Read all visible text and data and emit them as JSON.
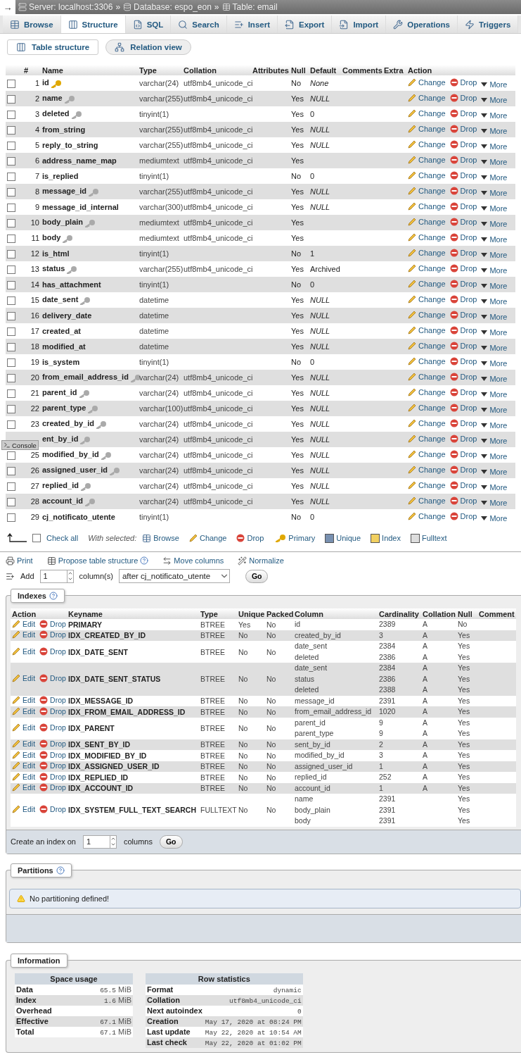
{
  "breadcrumb": {
    "arrow": "→",
    "separator": "»",
    "items": [
      {
        "label": "Server: localhost:3306"
      },
      {
        "label": "Database: espo_eon"
      },
      {
        "label": "Table: email"
      }
    ]
  },
  "tabs": [
    {
      "label": "Browse",
      "selected": false
    },
    {
      "label": "Structure",
      "selected": true
    },
    {
      "label": "SQL",
      "selected": false
    },
    {
      "label": "Search",
      "selected": false
    },
    {
      "label": "Insert",
      "selected": false
    },
    {
      "label": "Export",
      "selected": false
    },
    {
      "label": "Import",
      "selected": false
    },
    {
      "label": "Operations",
      "selected": false
    },
    {
      "label": "Triggers",
      "selected": false
    }
  ],
  "subtabs": [
    {
      "label": "Table structure",
      "selected": true
    },
    {
      "label": "Relation view",
      "selected": false
    }
  ],
  "structure": {
    "columns": [
      "#",
      "Name",
      "Type",
      "Collation",
      "Attributes",
      "Null",
      "Default",
      "Comments",
      "Extra",
      "Action"
    ],
    "rows": [
      {
        "checked": false,
        "num": "1",
        "name": "id",
        "kind": "primary",
        "type": "varchar(24)",
        "collation": "utf8mb4_unicode_ci",
        "null": "No",
        "default": "None",
        "default_keyword": true,
        "actions": [
          "Change",
          "Drop",
          "More"
        ]
      },
      {
        "checked": false,
        "num": "2",
        "name": "name",
        "kind": "indexed",
        "type": "varchar(255)",
        "collation": "utf8mb4_unicode_ci",
        "null": "Yes",
        "default": "NULL",
        "default_keyword": true,
        "actions": [
          "Change",
          "Drop",
          "More"
        ]
      },
      {
        "checked": false,
        "num": "3",
        "name": "deleted",
        "kind": "indexed",
        "type": "tinyint(1)",
        "null": "Yes",
        "default": "0",
        "actions": [
          "Change",
          "Drop",
          "More"
        ]
      },
      {
        "checked": false,
        "num": "4",
        "name": "from_string",
        "type": "varchar(255)",
        "collation": "utf8mb4_unicode_ci",
        "null": "Yes",
        "default": "NULL",
        "default_keyword": true,
        "actions": [
          "Change",
          "Drop",
          "More"
        ]
      },
      {
        "checked": false,
        "num": "5",
        "name": "reply_to_string",
        "type": "varchar(255)",
        "collation": "utf8mb4_unicode_ci",
        "null": "Yes",
        "default": "NULL",
        "default_keyword": true,
        "actions": [
          "Change",
          "Drop",
          "More"
        ]
      },
      {
        "checked": false,
        "num": "6",
        "name": "address_name_map",
        "type": "mediumtext",
        "collation": "utf8mb4_unicode_ci",
        "null": "Yes",
        "actions": [
          "Change",
          "Drop",
          "More"
        ]
      },
      {
        "checked": false,
        "num": "7",
        "name": "is_replied",
        "type": "tinyint(1)",
        "null": "No",
        "default": "0",
        "actions": [
          "Change",
          "Drop",
          "More"
        ]
      },
      {
        "checked": false,
        "num": "8",
        "name": "message_id",
        "kind": "indexed",
        "type": "varchar(255)",
        "collation": "utf8mb4_unicode_ci",
        "null": "Yes",
        "default": "NULL",
        "default_keyword": true,
        "actions": [
          "Change",
          "Drop",
          "More"
        ]
      },
      {
        "checked": false,
        "num": "9",
        "name": "message_id_internal",
        "type": "varchar(300)",
        "collation": "utf8mb4_unicode_ci",
        "null": "Yes",
        "default": "NULL",
        "default_keyword": true,
        "actions": [
          "Change",
          "Drop",
          "More"
        ]
      },
      {
        "checked": false,
        "num": "10",
        "name": "body_plain",
        "kind": "indexed",
        "type": "mediumtext",
        "collation": "utf8mb4_unicode_ci",
        "null": "Yes",
        "actions": [
          "Change",
          "Drop",
          "More"
        ]
      },
      {
        "checked": false,
        "num": "11",
        "name": "body",
        "kind": "indexed",
        "type": "mediumtext",
        "collation": "utf8mb4_unicode_ci",
        "null": "Yes",
        "actions": [
          "Change",
          "Drop",
          "More"
        ]
      },
      {
        "checked": false,
        "num": "12",
        "name": "is_html",
        "type": "tinyint(1)",
        "null": "No",
        "default": "1",
        "actions": [
          "Change",
          "Drop",
          "More"
        ]
      },
      {
        "checked": false,
        "num": "13",
        "name": "status",
        "kind": "indexed",
        "type": "varchar(255)",
        "collation": "utf8mb4_unicode_ci",
        "null": "Yes",
        "default": "Archived",
        "actions": [
          "Change",
          "Drop",
          "More"
        ]
      },
      {
        "checked": false,
        "num": "14",
        "name": "has_attachment",
        "type": "tinyint(1)",
        "null": "No",
        "default": "0",
        "actions": [
          "Change",
          "Drop",
          "More"
        ]
      },
      {
        "checked": false,
        "num": "15",
        "name": "date_sent",
        "kind": "indexed",
        "type": "datetime",
        "null": "Yes",
        "default": "NULL",
        "default_keyword": true,
        "actions": [
          "Change",
          "Drop",
          "More"
        ]
      },
      {
        "checked": false,
        "num": "16",
        "name": "delivery_date",
        "type": "datetime",
        "null": "Yes",
        "default": "NULL",
        "default_keyword": true,
        "actions": [
          "Change",
          "Drop",
          "More"
        ]
      },
      {
        "checked": false,
        "num": "17",
        "name": "created_at",
        "type": "datetime",
        "null": "Yes",
        "default": "NULL",
        "default_keyword": true,
        "actions": [
          "Change",
          "Drop",
          "More"
        ]
      },
      {
        "checked": false,
        "num": "18",
        "name": "modified_at",
        "type": "datetime",
        "null": "Yes",
        "default": "NULL",
        "default_keyword": true,
        "actions": [
          "Change",
          "Drop",
          "More"
        ]
      },
      {
        "checked": false,
        "num": "19",
        "name": "is_system",
        "type": "tinyint(1)",
        "null": "No",
        "default": "0",
        "actions": [
          "Change",
          "Drop",
          "More"
        ]
      },
      {
        "checked": false,
        "num": "20",
        "name": "from_email_address_id",
        "kind": "indexed",
        "type": "varchar(24)",
        "collation": "utf8mb4_unicode_ci",
        "null": "Yes",
        "default": "NULL",
        "default_keyword": true,
        "actions": [
          "Change",
          "Drop",
          "More"
        ]
      },
      {
        "checked": false,
        "num": "21",
        "name": "parent_id",
        "kind": "indexed",
        "type": "varchar(24)",
        "collation": "utf8mb4_unicode_ci",
        "null": "Yes",
        "default": "NULL",
        "default_keyword": true,
        "actions": [
          "Change",
          "Drop",
          "More"
        ]
      },
      {
        "checked": false,
        "num": "22",
        "name": "parent_type",
        "kind": "indexed",
        "type": "varchar(100)",
        "collation": "utf8mb4_unicode_ci",
        "null": "Yes",
        "default": "NULL",
        "default_keyword": true,
        "actions": [
          "Change",
          "Drop",
          "More"
        ]
      },
      {
        "checked": false,
        "num": "23",
        "name": "created_by_id",
        "kind": "indexed",
        "type": "varchar(24)",
        "collation": "utf8mb4_unicode_ci",
        "null": "Yes",
        "default": "NULL",
        "default_keyword": true,
        "actions": [
          "Change",
          "Drop",
          "More"
        ]
      },
      {
        "name": "ent_by_id",
        "kind": "indexed",
        "type": "varchar(24)",
        "collation": "utf8mb4_unicode_ci",
        "null": "Yes",
        "default": "NULL",
        "default_keyword": true,
        "actions": [
          "Change",
          "Drop",
          "More"
        ]
      },
      {
        "checked": false,
        "num": "25",
        "name": "modified_by_id",
        "kind": "indexed",
        "type": "varchar(24)",
        "collation": "utf8mb4_unicode_ci",
        "null": "Yes",
        "default": "NULL",
        "default_keyword": true,
        "actions": [
          "Change",
          "Drop",
          "More"
        ]
      },
      {
        "checked": false,
        "num": "26",
        "name": "assigned_user_id",
        "kind": "indexed",
        "type": "varchar(24)",
        "collation": "utf8mb4_unicode_ci",
        "null": "Yes",
        "default": "NULL",
        "default_keyword": true,
        "actions": [
          "Change",
          "Drop",
          "More"
        ]
      },
      {
        "checked": false,
        "num": "27",
        "name": "replied_id",
        "kind": "indexed",
        "type": "varchar(24)",
        "collation": "utf8mb4_unicode_ci",
        "null": "Yes",
        "default": "NULL",
        "default_keyword": true,
        "actions": [
          "Change",
          "Drop",
          "More"
        ]
      },
      {
        "checked": false,
        "num": "28",
        "name": "account_id",
        "kind": "indexed",
        "type": "varchar(24)",
        "collation": "utf8mb4_unicode_ci",
        "null": "Yes",
        "default": "NULL",
        "default_keyword": true,
        "actions": [
          "Change",
          "Drop",
          "More"
        ]
      },
      {
        "checked": false,
        "num": "29",
        "name": "cj_notificato_utente",
        "type": "tinyint(1)",
        "null": "No",
        "default": "0",
        "actions": [
          "Change",
          "Drop",
          "More"
        ]
      }
    ],
    "check_all": {
      "label": "Check all",
      "checked": false
    },
    "with_selected": "With selected:",
    "bulk_actions": [
      "Browse",
      "Change",
      "Drop",
      "Primary",
      "Unique",
      "Index",
      "Fulltext"
    ]
  },
  "console": {
    "label": "Console"
  },
  "links": [
    "Print",
    "Propose table structure",
    "Move columns",
    "Normalize"
  ],
  "add_columns": {
    "label": "Add",
    "count": "1",
    "unit": "column(s)",
    "position": "after cj_notificato_utente",
    "go": "Go"
  },
  "indexes": {
    "title": "Indexes",
    "columns": [
      "Action",
      "Keyname",
      "Type",
      "Unique",
      "Packed",
      "Column",
      "Cardinality",
      "Collation",
      "Null",
      "Comment"
    ],
    "rows": [
      {
        "actions": [
          "Edit",
          "Drop"
        ],
        "keyname": "PRIMARY",
        "type": "BTREE",
        "unique": "Yes",
        "packed": "No",
        "parts": [
          {
            "column": "id",
            "cardinality": "2389",
            "collation": "A",
            "null": "No"
          }
        ]
      },
      {
        "actions": [
          "Edit",
          "Drop"
        ],
        "keyname": "IDX_CREATED_BY_ID",
        "type": "BTREE",
        "unique": "No",
        "packed": "No",
        "parts": [
          {
            "column": "created_by_id",
            "cardinality": "3",
            "collation": "A",
            "null": "Yes"
          }
        ]
      },
      {
        "actions": [
          "Edit",
          "Drop"
        ],
        "keyname": "IDX_DATE_SENT",
        "type": "BTREE",
        "unique": "No",
        "packed": "No",
        "parts": [
          {
            "column": "date_sent",
            "cardinality": "2384",
            "collation": "A",
            "null": "Yes"
          },
          {
            "column": "deleted",
            "cardinality": "2386",
            "collation": "A",
            "null": "Yes"
          }
        ]
      },
      {
        "actions": [
          "Edit",
          "Drop"
        ],
        "keyname": "IDX_DATE_SENT_STATUS",
        "type": "BTREE",
        "unique": "No",
        "packed": "No",
        "parts": [
          {
            "column": "date_sent",
            "cardinality": "2384",
            "collation": "A",
            "null": "Yes"
          },
          {
            "column": "status",
            "cardinality": "2386",
            "collation": "A",
            "null": "Yes"
          },
          {
            "column": "deleted",
            "cardinality": "2388",
            "collation": "A",
            "null": "Yes"
          }
        ]
      },
      {
        "actions": [
          "Edit",
          "Drop"
        ],
        "keyname": "IDX_MESSAGE_ID",
        "type": "BTREE",
        "unique": "No",
        "packed": "No",
        "parts": [
          {
            "column": "message_id",
            "cardinality": "2391",
            "collation": "A",
            "null": "Yes"
          }
        ]
      },
      {
        "actions": [
          "Edit",
          "Drop"
        ],
        "keyname": "IDX_FROM_EMAIL_ADDRESS_ID",
        "type": "BTREE",
        "unique": "No",
        "packed": "No",
        "parts": [
          {
            "column": "from_email_address_id",
            "cardinality": "1020",
            "collation": "A",
            "null": "Yes"
          }
        ]
      },
      {
        "actions": [
          "Edit",
          "Drop"
        ],
        "keyname": "IDX_PARENT",
        "type": "BTREE",
        "unique": "No",
        "packed": "No",
        "parts": [
          {
            "column": "parent_id",
            "cardinality": "9",
            "collation": "A",
            "null": "Yes"
          },
          {
            "column": "parent_type",
            "cardinality": "9",
            "collation": "A",
            "null": "Yes"
          }
        ]
      },
      {
        "actions": [
          "Edit",
          "Drop"
        ],
        "keyname": "IDX_SENT_BY_ID",
        "type": "BTREE",
        "unique": "No",
        "packed": "No",
        "parts": [
          {
            "column": "sent_by_id",
            "cardinality": "2",
            "collation": "A",
            "null": "Yes"
          }
        ]
      },
      {
        "actions": [
          "Edit",
          "Drop"
        ],
        "keyname": "IDX_MODIFIED_BY_ID",
        "type": "BTREE",
        "unique": "No",
        "packed": "No",
        "parts": [
          {
            "column": "modified_by_id",
            "cardinality": "3",
            "collation": "A",
            "null": "Yes"
          }
        ]
      },
      {
        "actions": [
          "Edit",
          "Drop"
        ],
        "keyname": "IDX_ASSIGNED_USER_ID",
        "type": "BTREE",
        "unique": "No",
        "packed": "No",
        "parts": [
          {
            "column": "assigned_user_id",
            "cardinality": "1",
            "collation": "A",
            "null": "Yes"
          }
        ]
      },
      {
        "actions": [
          "Edit",
          "Drop"
        ],
        "keyname": "IDX_REPLIED_ID",
        "type": "BTREE",
        "unique": "No",
        "packed": "No",
        "parts": [
          {
            "column": "replied_id",
            "cardinality": "252",
            "collation": "A",
            "null": "Yes"
          }
        ]
      },
      {
        "actions": [
          "Edit",
          "Drop"
        ],
        "keyname": "IDX_ACCOUNT_ID",
        "type": "BTREE",
        "unique": "No",
        "packed": "No",
        "parts": [
          {
            "column": "account_id",
            "cardinality": "1",
            "collation": "A",
            "null": "Yes"
          }
        ]
      },
      {
        "actions": [
          "Edit",
          "Drop"
        ],
        "keyname": "IDX_SYSTEM_FULL_TEXT_SEARCH",
        "type": "FULLTEXT",
        "unique": "No",
        "packed": "No",
        "parts": [
          {
            "column": "name",
            "cardinality": "2391",
            "null": "Yes"
          },
          {
            "column": "body_plain",
            "cardinality": "2391",
            "null": "Yes"
          },
          {
            "column": "body",
            "cardinality": "2391",
            "null": "Yes"
          }
        ]
      }
    ],
    "create": {
      "label": "Create an index on",
      "count": "1",
      "unit": "columns",
      "go": "Go"
    }
  },
  "partitions": {
    "title": "Partitions",
    "message": "No partitioning defined!"
  },
  "information": {
    "title": "Information",
    "space_usage": {
      "title": "Space usage",
      "rows": [
        {
          "label": "Data",
          "value": "65.5",
          "unit": "MiB"
        },
        {
          "label": "Index",
          "value": "1.6",
          "unit": "MiB"
        },
        {
          "label": "Overhead"
        },
        {
          "label": "Effective",
          "value": "67.1",
          "unit": "MiB"
        },
        {
          "label": "Total",
          "value": "67.1",
          "unit": "MiB"
        }
      ]
    },
    "row_statistics": {
      "title": "Row statistics",
      "rows": [
        {
          "label": "Format",
          "value": "dynamic"
        },
        {
          "label": "Collation",
          "value": "utf8mb4_unicode_ci"
        },
        {
          "label": "Next autoindex",
          "value": "0"
        },
        {
          "label": "Creation",
          "value": "May 17, 2020 at 08:24 PM"
        },
        {
          "label": "Last update",
          "value": "May 22, 2020 at 10:54 AM"
        },
        {
          "label": "Last check",
          "value": "May 22, 2020 at 01:02 PM"
        }
      ]
    }
  }
}
